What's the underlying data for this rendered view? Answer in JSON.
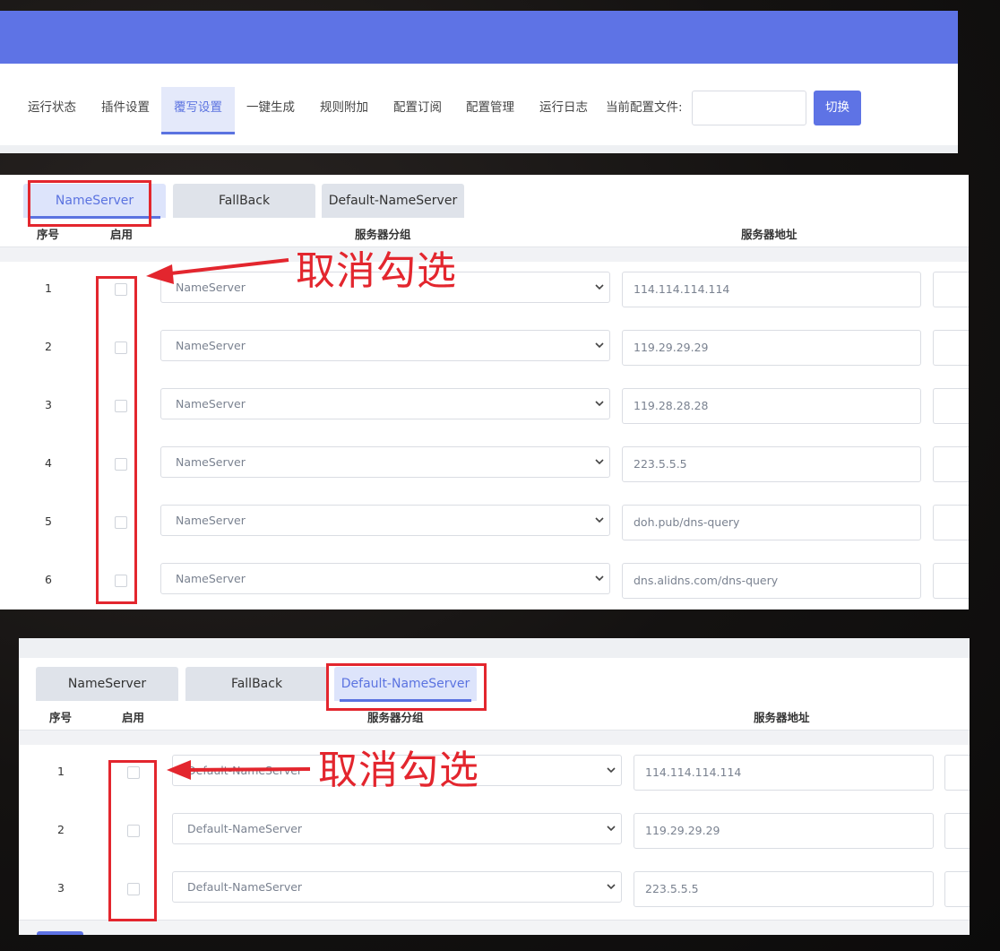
{
  "nav": {
    "items": [
      {
        "label": "运行状态",
        "active": false
      },
      {
        "label": "插件设置",
        "active": false
      },
      {
        "label": "覆写设置",
        "active": true
      },
      {
        "label": "一键生成",
        "active": false
      },
      {
        "label": "规则附加",
        "active": false
      },
      {
        "label": "配置订阅",
        "active": false
      },
      {
        "label": "配置管理",
        "active": false
      },
      {
        "label": "运行日志",
        "active": false
      }
    ],
    "config_label": "当前配置文件:",
    "config_value": "",
    "switch_label": "切换"
  },
  "panel1": {
    "tabs": [
      "NameServer",
      "FallBack",
      "Default-NameServer"
    ],
    "active_tab": "NameServer",
    "columns": {
      "index": "序号",
      "enabled": "启用",
      "group": "服务器分组",
      "address": "服务器地址"
    },
    "rows": [
      {
        "index": "1",
        "enabled": false,
        "group": "NameServer",
        "address": "114.114.114.114"
      },
      {
        "index": "2",
        "enabled": false,
        "group": "NameServer",
        "address": "119.29.29.29"
      },
      {
        "index": "3",
        "enabled": false,
        "group": "NameServer",
        "address": "119.28.28.28"
      },
      {
        "index": "4",
        "enabled": false,
        "group": "NameServer",
        "address": "223.5.5.5"
      },
      {
        "index": "5",
        "enabled": false,
        "group": "NameServer",
        "address": "doh.pub/dns-query"
      },
      {
        "index": "6",
        "enabled": false,
        "group": "NameServer",
        "address": "dns.alidns.com/dns-query"
      }
    ]
  },
  "panel2": {
    "tabs": [
      "NameServer",
      "FallBack",
      "Default-NameServer"
    ],
    "active_tab": "Default-NameServer",
    "columns": {
      "index": "序号",
      "enabled": "启用",
      "group": "服务器分组",
      "address": "服务器地址"
    },
    "rows": [
      {
        "index": "1",
        "enabled": false,
        "group": "Default-NameServer",
        "address": "114.114.114.114"
      },
      {
        "index": "2",
        "enabled": false,
        "group": "Default-NameServer",
        "address": "119.29.29.29"
      },
      {
        "index": "3",
        "enabled": false,
        "group": "Default-NameServer",
        "address": "223.5.5.5"
      }
    ]
  },
  "annotations": {
    "uncheck_text_1": "取消勾选",
    "uncheck_text_2": "取消勾选",
    "color": "#e3262e"
  },
  "colors": {
    "accent": "#5e73e5",
    "active_tab_text": "#5b73e0"
  }
}
